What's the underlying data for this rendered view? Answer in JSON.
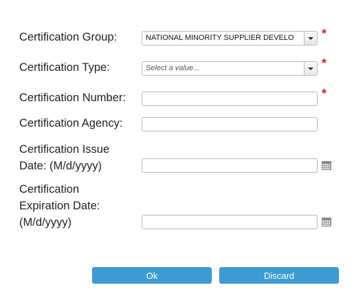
{
  "form": {
    "group": {
      "label": "Certification Group:",
      "value": "NATIONAL MINORITY SUPPLIER DEVELO",
      "required_marker": "*"
    },
    "type": {
      "label": "Certification Type:",
      "placeholder": "Select a value...",
      "required_marker": "*"
    },
    "number": {
      "label": "Certification Number:",
      "value": "",
      "required_marker": "*"
    },
    "agency": {
      "label": "Certification Agency:",
      "value": ""
    },
    "issue_date": {
      "label_line1": "Certification Issue",
      "label_line2": "Date: (M/d/yyyy)",
      "value": ""
    },
    "expiration_date": {
      "label_line1": "Certification",
      "label_line2": "Expiration Date:",
      "label_line3": "(M/d/yyyy)",
      "value": ""
    }
  },
  "buttons": {
    "ok": "Ok",
    "discard": "Discard"
  },
  "colors": {
    "button_bg": "#3e9cd2",
    "required": "#c0272d"
  },
  "icons": {
    "dropdown": "chevron-down-icon",
    "calendar": "calendar-icon"
  }
}
